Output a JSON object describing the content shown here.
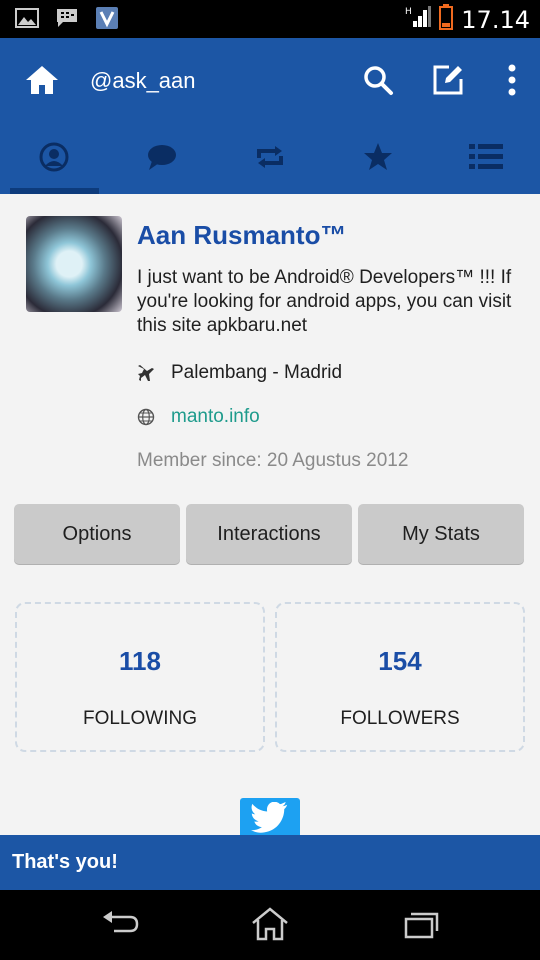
{
  "status_bar": {
    "time": "17.14",
    "icons": [
      "gallery-icon",
      "bbm-icon",
      "v-app-icon",
      "signal-icon",
      "battery-icon"
    ]
  },
  "action_bar": {
    "title": "@ask_aan",
    "icons": [
      "home-icon",
      "search-icon",
      "compose-icon",
      "overflow-menu-icon"
    ]
  },
  "tabs": [
    {
      "name": "profile",
      "icon": "profile-icon",
      "selected": true
    },
    {
      "name": "messages",
      "icon": "chat-bubble-icon",
      "selected": false
    },
    {
      "name": "retweets",
      "icon": "retweet-icon",
      "selected": false
    },
    {
      "name": "favorites",
      "icon": "star-icon",
      "selected": false
    },
    {
      "name": "lists",
      "icon": "list-icon",
      "selected": false
    }
  ],
  "profile": {
    "name": "Aan Rusmanto™",
    "bio": "I just want to be Android® Developers™ !!! If you're looking for android apps, you can visit this site  apkbaru.net",
    "location": "Palembang - Madrid",
    "website": "manto.info",
    "member_since": "Member since: 20 Agustus 2012"
  },
  "buttons": {
    "options": "Options",
    "interactions": "Interactions",
    "my_stats": "My Stats"
  },
  "stats": {
    "following_count": "118",
    "following_label": "FOLLOWING",
    "followers_count": "154",
    "followers_label": "FOLLOWERS"
  },
  "toast": {
    "text": "That's you!"
  },
  "colors": {
    "brand_blue": "#1c56a5",
    "name_blue": "#1a4da6",
    "link_teal": "#1e9b8c",
    "twitter_blue": "#1da1f2"
  },
  "nav_bar": {
    "icons": [
      "back-icon",
      "home-nav-icon",
      "recent-apps-icon"
    ]
  }
}
